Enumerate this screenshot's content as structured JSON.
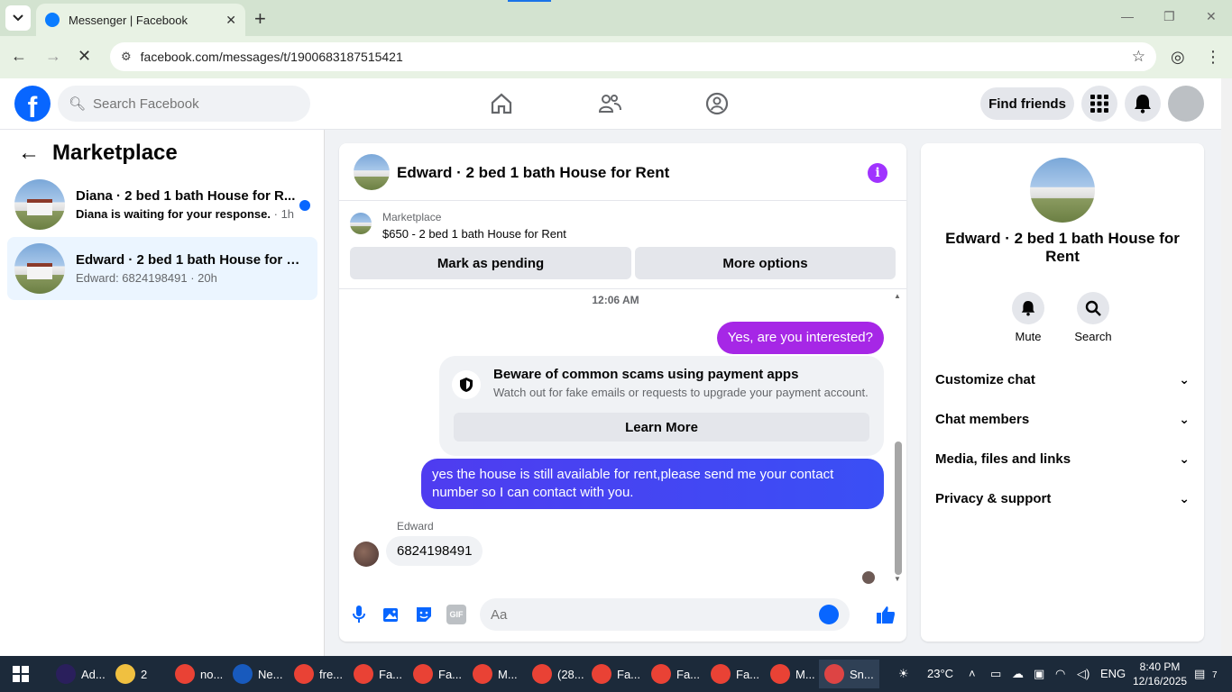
{
  "browser": {
    "tab_title": "Messenger | Facebook",
    "url": "facebook.com/messages/t/1900683187515421"
  },
  "fb_header": {
    "search_placeholder": "Search Facebook",
    "find_friends": "Find friends"
  },
  "sidebar": {
    "title": "Marketplace",
    "conversations": [
      {
        "name": "Diana · 2 bed 1 bath House for R...",
        "preview": "Diana is waiting for your response.",
        "time": "· 1h",
        "unread": true
      },
      {
        "name": "Edward · 2 bed 1 bath House for R...",
        "preview": "Edward: 6824198491 · 20h",
        "unread": false
      }
    ]
  },
  "chat": {
    "title": "Edward · 2 bed 1 bath House for Rent",
    "listing_label": "Marketplace",
    "listing_price": "$650 - 2 bed 1 bath House for Rent",
    "btn_pending": "Mark as pending",
    "btn_more": "More options",
    "timestamp": "12:06 AM",
    "msg1": "Yes, are you interested?",
    "warning_title": "Beware of common scams using payment apps",
    "warning_sub": "Watch out for fake emails or requests to upgrade your payment account.",
    "learn_more": "Learn More",
    "msg2": "yes the house is still available for rent,please send me your contact number so I can contact with you.",
    "sender": "Edward",
    "incoming": "6824198491",
    "composer_placeholder": "Aa",
    "gif_label": "GIF"
  },
  "right_panel": {
    "name": "Edward · 2 bed 1 bath House for Rent",
    "mute": "Mute",
    "search": "Search",
    "sections": [
      "Customize chat",
      "Chat members",
      "Media, files and links",
      "Privacy & support"
    ]
  },
  "taskbar": {
    "items": [
      {
        "label": "Ad...",
        "color": "#2a1f5c"
      },
      {
        "label": "2",
        "color": "#f0c040"
      },
      {
        "label": "no...",
        "color": "#e94235"
      },
      {
        "label": "Ne...",
        "color": "#185abd"
      },
      {
        "label": "fre...",
        "color": "#e94235"
      },
      {
        "label": "Fa...",
        "color": "#e94235"
      },
      {
        "label": "Fa...",
        "color": "#e94235"
      },
      {
        "label": "M...",
        "color": "#e94235"
      },
      {
        "label": "(28...",
        "color": "#e94235"
      },
      {
        "label": "Fa...",
        "color": "#e94235"
      },
      {
        "label": "Fa...",
        "color": "#e94235"
      },
      {
        "label": "Fa...",
        "color": "#e94235"
      },
      {
        "label": "M...",
        "color": "#e94235"
      },
      {
        "label": "Sn...",
        "color": "#d44"
      }
    ],
    "weather": "23°C",
    "lang": "ENG",
    "time": "8:40 PM",
    "date": "12/16/2025",
    "notif_count": "7"
  }
}
